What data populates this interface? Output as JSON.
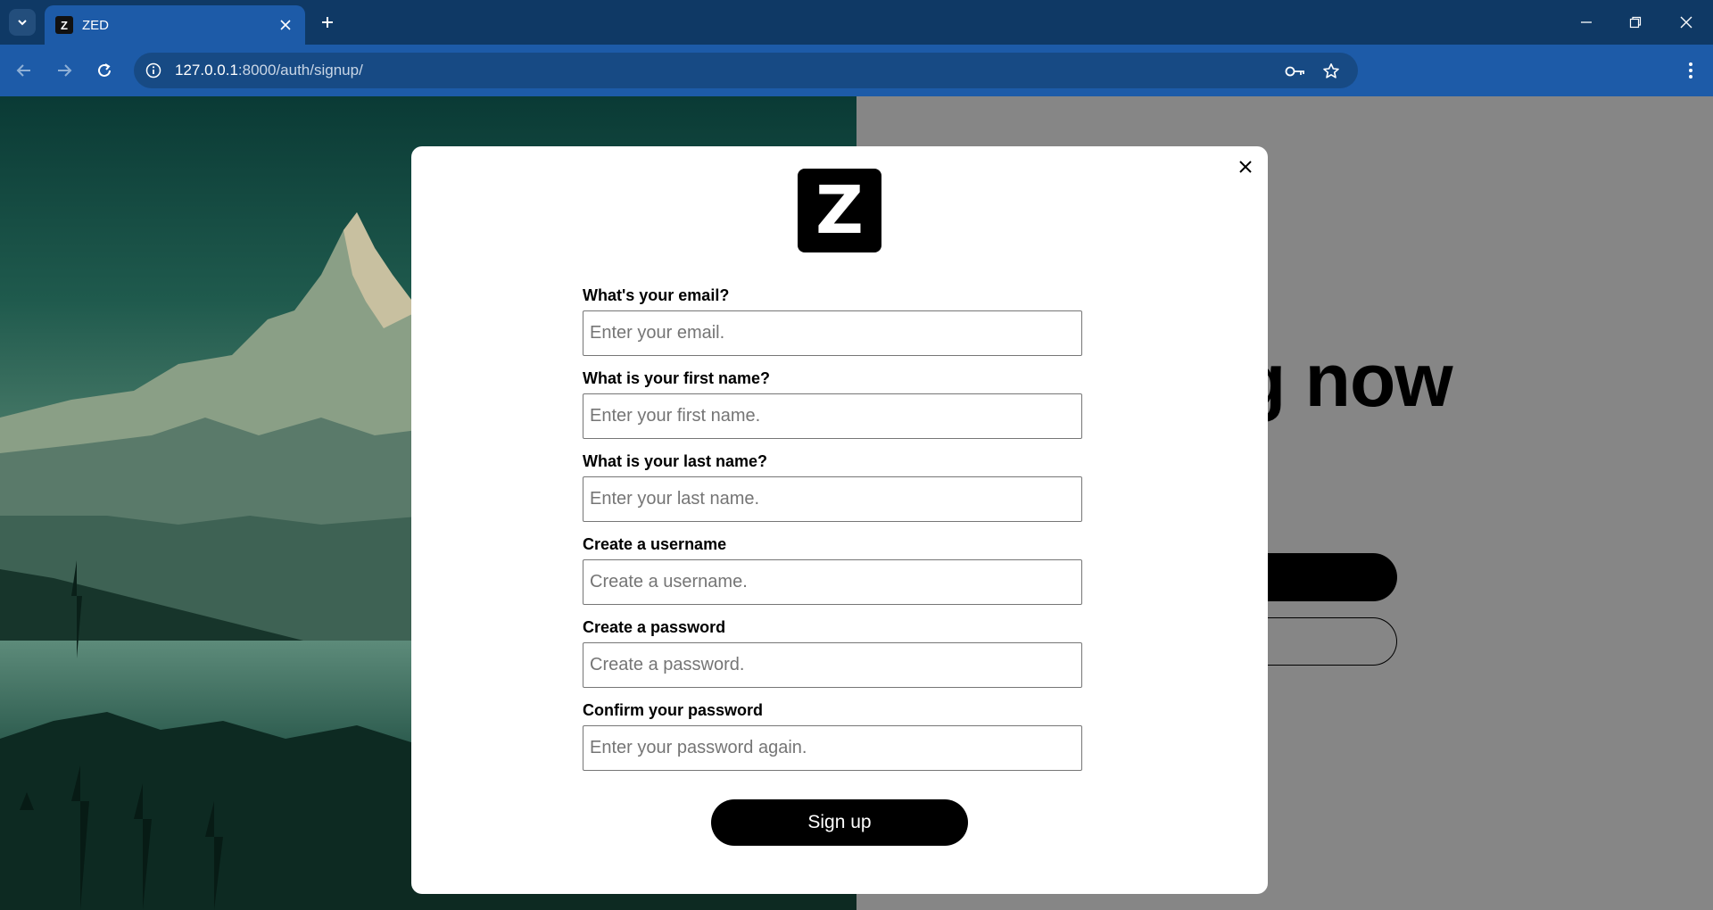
{
  "browser": {
    "tab": {
      "favicon_letter": "Z",
      "title": "ZED"
    },
    "url_host": "127.0.0.1",
    "url_path": ":8000/auth/signup/",
    "icons": {
      "tab_search": "chevron-down-icon",
      "tab_close": "close-icon",
      "new_tab": "plus-icon",
      "minimize": "minimize-icon",
      "restore": "restore-icon",
      "close": "close-icon",
      "back": "arrow-left-icon",
      "forward": "arrow-right-icon",
      "reload": "reload-icon",
      "site_info": "info-icon",
      "password_manager": "key-icon",
      "bookmark": "star-icon",
      "menu": "kebab-menu-icon"
    }
  },
  "background": {
    "heading_visible": "g now"
  },
  "modal": {
    "logo_letter": "Z",
    "fields": [
      {
        "label": "What's your email?",
        "placeholder": "Enter your email.",
        "value": ""
      },
      {
        "label": "What is your first name?",
        "placeholder": "Enter your first name.",
        "value": ""
      },
      {
        "label": "What is your last name?",
        "placeholder": "Enter your last name.",
        "value": ""
      },
      {
        "label": "Create a username",
        "placeholder": "Create a username.",
        "value": ""
      },
      {
        "label": "Create a password",
        "placeholder": "Create a password.",
        "value": ""
      },
      {
        "label": "Confirm your password",
        "placeholder": "Enter your password again.",
        "value": ""
      }
    ],
    "submit_label": "Sign up"
  },
  "colors": {
    "tabbar_bg": "#0f3965",
    "toolbar_bg": "#1d5ba8",
    "overlay_gray": "#868686",
    "accent": "#000000"
  }
}
